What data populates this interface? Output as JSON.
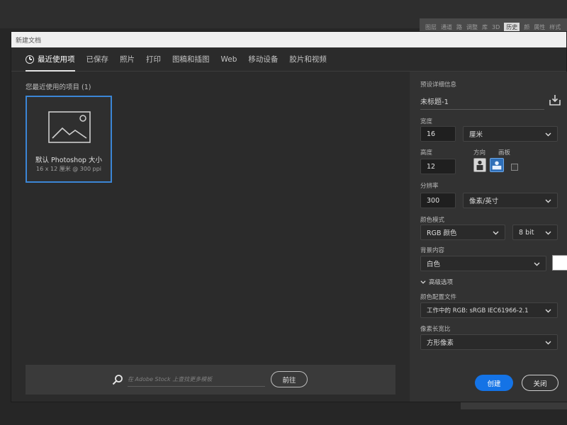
{
  "background_app": {
    "workspace_tabs": [
      "图层",
      "通道",
      "路",
      "调整",
      "库",
      "3D",
      "历史",
      "颜",
      "属性",
      "样式"
    ],
    "active_index": 6
  },
  "dialog": {
    "title": "新建文档",
    "tabs": [
      "最近使用项",
      "已保存",
      "照片",
      "打印",
      "图稿和插图",
      "Web",
      "移动设备",
      "胶片和视频"
    ],
    "active_tab": 0
  },
  "recent": {
    "heading": "您最近使用的项目 (1)",
    "presets": [
      {
        "name": "默认 Photoshop 大小",
        "size": "16 x 12 厘米 @ 300 ppi",
        "selected": true,
        "icon": "image-placeholder-icon"
      }
    ]
  },
  "stock": {
    "placeholder": "在 Adobe Stock 上查找更多模板",
    "button": "前往",
    "icon": "search-icon"
  },
  "details": {
    "header": "预设详细信息",
    "doc_name": "未标题-1",
    "width_label": "宽度",
    "width_value": "16",
    "width_unit": "厘米",
    "height_label": "高度",
    "height_value": "12",
    "orientation_label": "方向",
    "artboard_label": "画板",
    "resolution_label": "分辨率",
    "resolution_value": "300",
    "resolution_unit": "像素/英寸",
    "color_mode_label": "颜色模式",
    "color_mode": "RGB 颜色",
    "bit_depth": "8 bit",
    "bg_label": "背景内容",
    "bg_value": "白色",
    "bg_color": "#ffffff",
    "advanced_label": "高级选项",
    "profile_label": "颜色配置文件",
    "profile_value": "工作中的 RGB: sRGB IEC61966-2.1",
    "aspect_label": "像素长宽比",
    "aspect_value": "方形像素"
  },
  "buttons": {
    "create": "创建",
    "close": "关闭",
    "create_color": "#1473e6"
  }
}
